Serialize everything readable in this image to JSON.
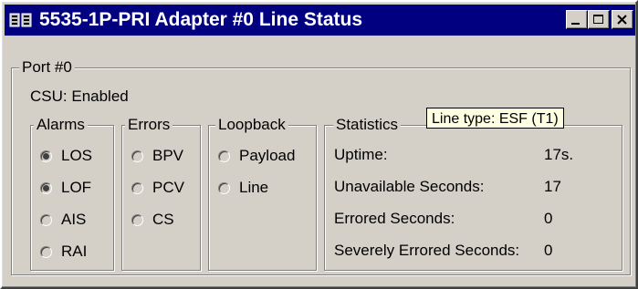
{
  "window": {
    "title": "5535-1P-PRI Adapter #0 Line Status",
    "icon": "adapter-icon"
  },
  "port": {
    "label": "Port #0",
    "csu_label": "CSU:",
    "csu_value": "Enabled"
  },
  "alarms": {
    "label": "Alarms",
    "items": [
      {
        "label": "LOS",
        "active": true
      },
      {
        "label": "LOF",
        "active": true
      },
      {
        "label": "AIS",
        "active": false
      },
      {
        "label": "RAI",
        "active": false
      }
    ]
  },
  "errors": {
    "label": "Errors",
    "items": [
      {
        "label": "BPV",
        "active": false
      },
      {
        "label": "PCV",
        "active": false
      },
      {
        "label": "CS",
        "active": false
      }
    ]
  },
  "loopback": {
    "label": "Loopback",
    "items": [
      {
        "label": "Payload",
        "active": false
      },
      {
        "label": "Line",
        "active": false
      }
    ]
  },
  "statistics": {
    "label": "Statistics",
    "rows": [
      {
        "label": "Uptime:",
        "value": "17s."
      },
      {
        "label": "Unavailable Seconds:",
        "value": "17"
      },
      {
        "label": "Errored Seconds:",
        "value": "0"
      },
      {
        "label": "Severely Errored Seconds:",
        "value": "0"
      }
    ]
  },
  "tooltip": {
    "text": "Line type: ESF (T1)"
  },
  "colors": {
    "titlebar": "#000080",
    "face": "#d4d0c8",
    "tooltip_bg": "#ffffe1"
  }
}
